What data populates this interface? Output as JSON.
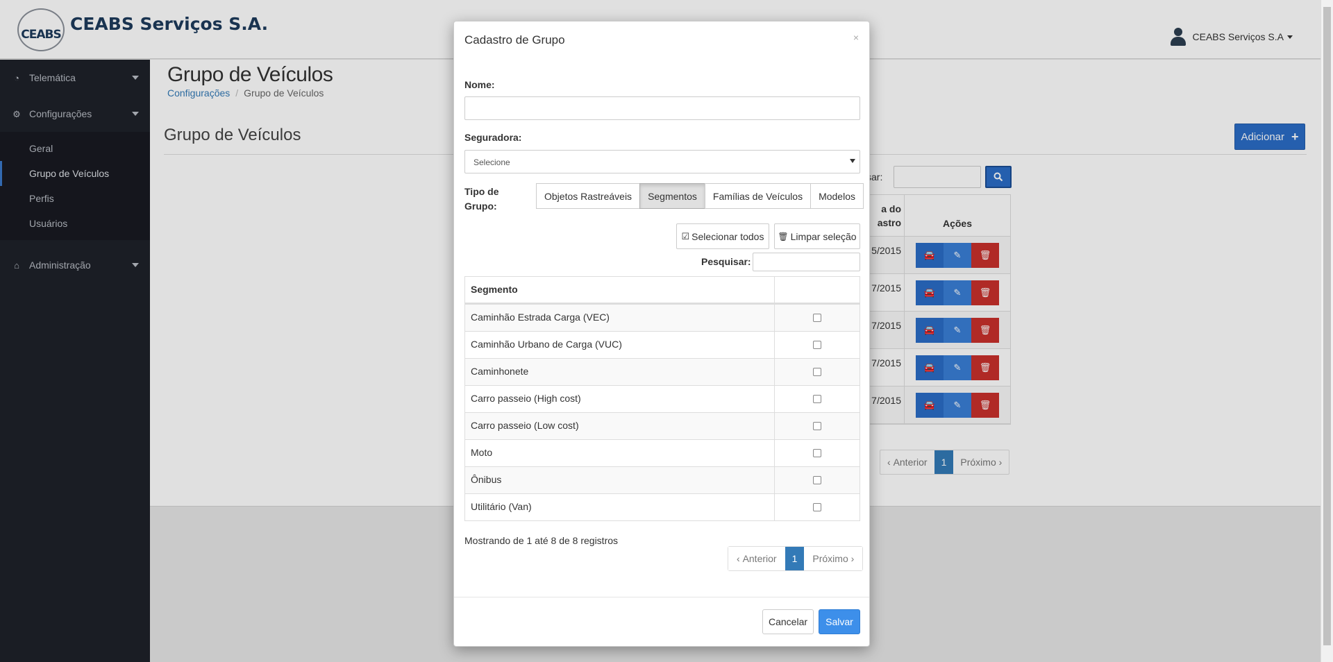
{
  "header": {
    "logo_text": "CEABS",
    "company_name": "CEABS Serviços S.A.",
    "user_name": "CEABS Serviços S.A"
  },
  "sidebar": {
    "items": [
      {
        "label": "Telemática",
        "icon": "dashboard-icon"
      },
      {
        "label": "Configurações",
        "icon": "cogs-icon"
      },
      {
        "label": "Administração",
        "icon": "bank-icon"
      }
    ],
    "sub_items": [
      "Geral",
      "Grupo de Veículos",
      "Perfis",
      "Usuários"
    ],
    "active_sub": "Grupo de Veículos"
  },
  "page": {
    "title": "Grupo de Veículos",
    "breadcrumb": [
      "Configurações",
      "Grupo de Veículos"
    ],
    "section_title": "Grupo de Veículos",
    "add_button": "Adicionar",
    "search_label": "sar:",
    "table_header_date_line1": "a do",
    "table_header_date_line2": "astro",
    "table_header_actions": "Ações",
    "rows": [
      "/2015",
      "/2015",
      "/2015",
      "/2015",
      "/2015"
    ],
    "row_prefix": [
      "5",
      "7",
      "7",
      "7",
      "7"
    ],
    "pager": {
      "prev": "Anterior",
      "current": "1",
      "next": "Próximo"
    }
  },
  "modal": {
    "title": "Cadastro de Grupo",
    "close": "×",
    "nome_label": "Nome:",
    "nome_value": "",
    "seguradora_label": "Seguradora:",
    "seguradora_value": "Selecione",
    "tipo_label": "Tipo de Grupo:",
    "tipo_options": [
      "Objetos Rastreáveis",
      "Segmentos",
      "Famílias de Veículos",
      "Modelos"
    ],
    "tipo_selected": "Segmentos",
    "select_all": "Selecionar todos",
    "clear_selection": "Limpar seleção",
    "search_label": "Pesquisar:",
    "search_value": "",
    "table_header": "Segmento",
    "segments": [
      {
        "name": "Caminhão Estrada Carga (VEC)",
        "checked": false
      },
      {
        "name": "Caminhão Urbano de Carga (VUC)",
        "checked": false
      },
      {
        "name": "Caminhonete",
        "checked": false
      },
      {
        "name": "Carro passeio (High cost)",
        "checked": false
      },
      {
        "name": "Carro passeio (Low cost)",
        "checked": false
      },
      {
        "name": "Moto",
        "checked": false
      },
      {
        "name": "Ônibus",
        "checked": false
      },
      {
        "name": "Utilitário (Van)",
        "checked": false
      }
    ],
    "info": "Mostrando de 1 até 8 de 8 registros",
    "pager": {
      "prev": "Anterior",
      "current": "1",
      "next": "Próximo"
    },
    "cancel": "Cancelar",
    "save": "Salvar"
  },
  "colors": {
    "primary": "#2b6dc6",
    "danger": "#c9302c",
    "sidebar_bg": "#1e2129",
    "save": "#3d8fea"
  }
}
